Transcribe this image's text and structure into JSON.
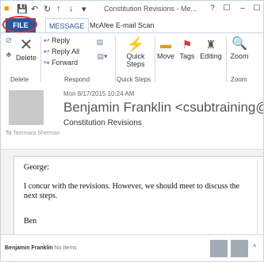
{
  "window": {
    "title": "Constitution Revisions - Me...",
    "help": "?",
    "display_options": "☐",
    "minimize": "–",
    "restore": "☐"
  },
  "tabs": {
    "file": "FILE",
    "message": "MESSAGE",
    "mcafee": "McAfee E-mail Scan"
  },
  "ribbon": {
    "delete": "Delete",
    "reply": "Reply",
    "reply_all": "Reply All",
    "forward": "Forward",
    "quick_steps": "Quick Steps",
    "move": "Move",
    "tags": "Tags",
    "editing": "Editing",
    "zoom": "Zoom",
    "group_delete": "Delete",
    "group_respond": "Respond",
    "group_quick_steps": "Quick Steps",
    "group_zoom": "Zoom"
  },
  "message": {
    "date": "Mon 8/17/2015 10:24 AM",
    "from": "Benjamin Franklin <csubtraining@gmai",
    "subject": "Constitution Revisions",
    "to_label": "To",
    "to": "Tammara Sherman",
    "greeting": "George:",
    "body": "I concur with the revisions.  However, we should meet to discuss the next steps.",
    "signature": "Ben"
  },
  "status": {
    "name": "Benjamin Franklin",
    "items": "No Items"
  },
  "colors": {
    "file_tab": "#2b579a",
    "highlight": "#dd3333"
  }
}
